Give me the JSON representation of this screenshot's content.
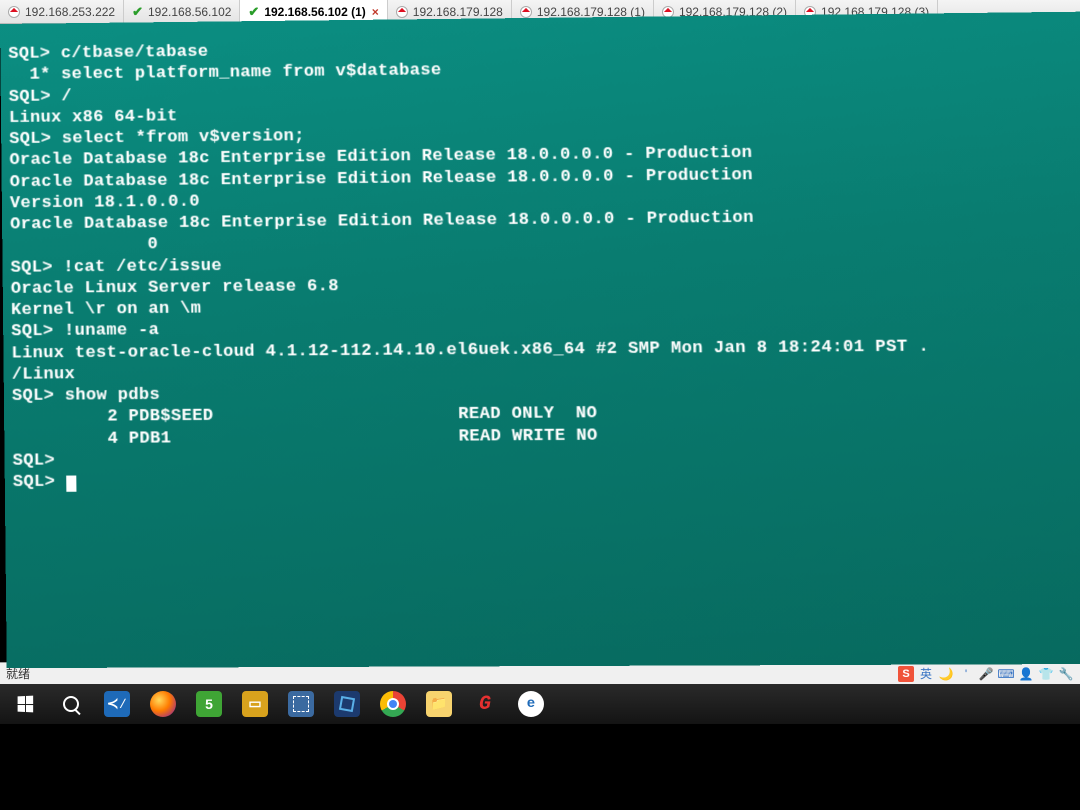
{
  "tabs": [
    {
      "label": "192.168.253.222",
      "style": "reddot",
      "active": false
    },
    {
      "label": "192.168.56.102",
      "style": "check",
      "active": false
    },
    {
      "label": "192.168.56.102 (1)",
      "style": "check",
      "active": true
    },
    {
      "label": "192.168.179.128",
      "style": "reddot",
      "active": false
    },
    {
      "label": "192.168.179.128 (1)",
      "style": "reddot",
      "active": false
    },
    {
      "label": "192.168.179.128 (2)",
      "style": "reddot",
      "active": false
    },
    {
      "label": "192.168.179.128 (3)",
      "style": "reddot",
      "active": false
    }
  ],
  "active_tab_close": "×",
  "terminal_lines": [
    "",
    "",
    "SQL> c/tbase/tabase",
    "  1* select platform_name from v$database",
    "SQL> /",
    "Linux x86 64-bit",
    "",
    "SQL> select *from v$version;",
    "Oracle Database 18c Enterprise Edition Release 18.0.0.0.0 - Production",
    "Oracle Database 18c Enterprise Edition Release 18.0.0.0.0 - Production",
    "Version 18.1.0.0.0",
    "Oracle Database 18c Enterprise Edition Release 18.0.0.0.0 - Production",
    "             0",
    "",
    "",
    "SQL> !cat /etc/issue",
    "Oracle Linux Server release 6.8",
    "Kernel \\r on an \\m",
    "",
    "",
    "SQL> !uname -a",
    "Linux test-oracle-cloud 4.1.12-112.14.10.el6uek.x86_64 #2 SMP Mon Jan 8 18:24:01 PST .",
    "/Linux",
    "",
    "SQL> show pdbs",
    "         2 PDB$SEED                       READ ONLY  NO",
    "         4 PDB1                           READ WRITE NO",
    "SQL>",
    "SQL> "
  ],
  "status": {
    "left": "就绪",
    "ime_badge": "S",
    "ime_lang": "英"
  },
  "taskbar": {
    "items": [
      "windows-start",
      "search",
      "vscode",
      "firefox",
      "camtasia",
      "vmware",
      "snipping-tool",
      "virtualbox",
      "chrome",
      "explorer",
      "foxit",
      "internet-explorer"
    ]
  }
}
